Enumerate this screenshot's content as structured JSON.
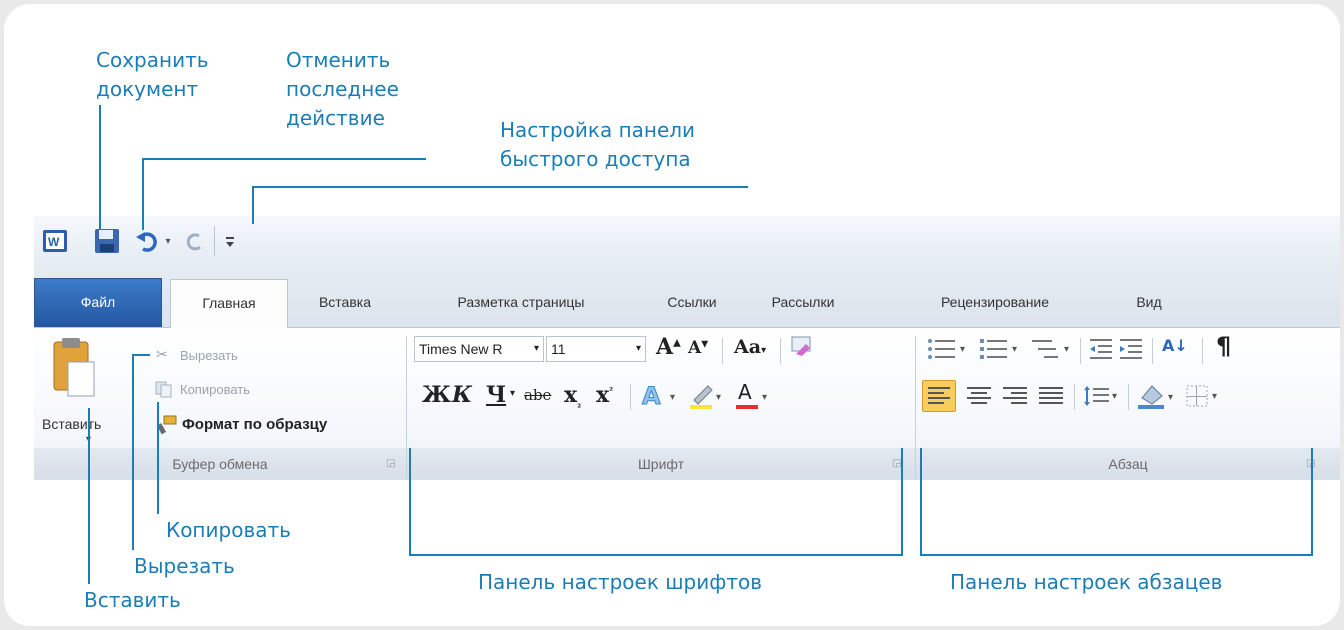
{
  "callouts": {
    "save": [
      "Сохранить",
      "документ"
    ],
    "undo": [
      "Отменить",
      "последнее",
      "действие"
    ],
    "customize": [
      "Настройка панели",
      "быстрого доступа"
    ],
    "paste": "Вставить",
    "cut": "Вырезать",
    "copy": "Копировать",
    "font_panel": "Панель настроек шрифтов",
    "paragraph_panel": "Панель настроек абзацев"
  },
  "ribbon_tabs": {
    "file": "Файл",
    "home": "Главная",
    "insert": "Вставка",
    "layout": "Разметка страницы",
    "references": "Ссылки",
    "mailings": "Рассылки",
    "review": "Рецензирование",
    "view": "Вид"
  },
  "clipboard": {
    "paste": "Вставить",
    "cut": "Вырезать",
    "copy": "Копировать",
    "format_painter": "Формат по образцу",
    "group_label": "Буфер обмена"
  },
  "font": {
    "name": "Times New R",
    "size": "11",
    "grow": "A",
    "shrink": "A",
    "change_case": "Aa",
    "bold": "Ж",
    "italic": "К",
    "underline": "Ч",
    "strike": "abe",
    "subscript": "x",
    "superscript": "x",
    "font_color": "A",
    "group_label": "Шрифт"
  },
  "paragraph": {
    "sort": "А↓",
    "pilcrow": "¶",
    "group_label": "Абзац"
  },
  "colors": {
    "callout": "#1b7db6",
    "file_tab": "#2e64b0",
    "highlight": "#f5c342"
  }
}
